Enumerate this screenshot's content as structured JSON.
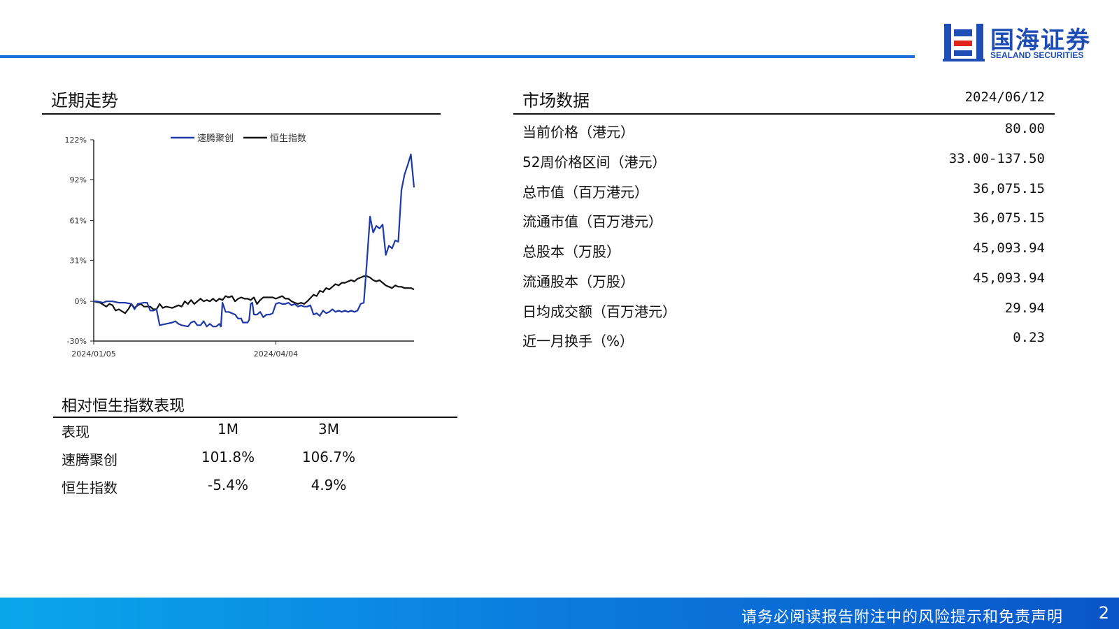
{
  "brand": {
    "name_cn": "国海证券",
    "name_en": "SEALAND SECURITIES",
    "primary_color": "#1f6fd6",
    "logo_blue": "#1d4db5",
    "logo_red": "#e2231a"
  },
  "trend": {
    "title": "近期走势"
  },
  "chart_data": {
    "type": "line",
    "title": "",
    "xlabel": "",
    "ylabel": "",
    "legend_position": "top",
    "ylim": [
      -30,
      122
    ],
    "y_ticks": [
      "122%",
      "92%",
      "61%",
      "31%",
      "0%",
      "-30%"
    ],
    "y_tick_values": [
      122,
      92,
      61,
      31,
      0,
      -30
    ],
    "x_ticks": [
      "2024/01/05",
      "2024/04/04"
    ],
    "x_tick_index": [
      0,
      58
    ],
    "n_points": 103,
    "series": [
      {
        "name": "速腾聚创",
        "color": "#1f3aa6",
        "points": [
          [
            0,
            0
          ],
          [
            1,
            0
          ],
          [
            3,
            -1
          ],
          [
            4,
            0
          ],
          [
            5,
            0
          ],
          [
            6,
            0
          ],
          [
            8,
            -1
          ],
          [
            10,
            -1
          ],
          [
            12,
            -2
          ],
          [
            13,
            -6
          ],
          [
            14,
            -2
          ],
          [
            16,
            -1
          ],
          [
            17,
            -1
          ],
          [
            18,
            -7
          ],
          [
            19,
            -7
          ],
          [
            20,
            -6
          ],
          [
            21,
            -18
          ],
          [
            23,
            -17
          ],
          [
            25,
            -16
          ],
          [
            26,
            -15
          ],
          [
            27,
            -17
          ],
          [
            28,
            -18
          ],
          [
            30,
            -19
          ],
          [
            31,
            -16
          ],
          [
            32,
            -15
          ],
          [
            33,
            -18
          ],
          [
            34,
            -18
          ],
          [
            35,
            -15
          ],
          [
            36,
            -19
          ],
          [
            37,
            -17
          ],
          [
            38,
            -19
          ],
          [
            39,
            -19
          ],
          [
            39.5,
            -18
          ],
          [
            40,
            -17
          ],
          [
            40.5,
            -19
          ],
          [
            41,
            -1
          ],
          [
            42,
            -8
          ],
          [
            43,
            -8
          ],
          [
            44,
            -9
          ],
          [
            45,
            -10
          ],
          [
            46,
            -13
          ],
          [
            47,
            -13
          ],
          [
            47.5,
            -16
          ],
          [
            48,
            -16
          ],
          [
            49,
            -16
          ],
          [
            49.5,
            -14
          ],
          [
            50,
            -2
          ],
          [
            50.5,
            -1
          ],
          [
            51,
            -10
          ],
          [
            52,
            -10
          ],
          [
            53,
            -8
          ],
          [
            54,
            -12
          ],
          [
            55,
            -10
          ],
          [
            56,
            -10
          ],
          [
            57,
            -9
          ],
          [
            58,
            -2
          ],
          [
            59,
            -1
          ],
          [
            60,
            -2
          ],
          [
            61,
            -2
          ],
          [
            62,
            -1
          ],
          [
            63,
            -3
          ],
          [
            64,
            -2
          ],
          [
            65,
            -4
          ],
          [
            66,
            -3
          ],
          [
            67,
            -4
          ],
          [
            68,
            -4
          ],
          [
            69,
            -3
          ],
          [
            70,
            -10
          ],
          [
            71,
            -9
          ],
          [
            72,
            -11
          ],
          [
            73,
            -7
          ],
          [
            74,
            -9
          ],
          [
            75,
            -8
          ],
          [
            76,
            -6
          ],
          [
            77,
            -8
          ],
          [
            78,
            -7
          ],
          [
            79,
            -8
          ],
          [
            80,
            -7
          ],
          [
            81,
            -8
          ],
          [
            82,
            -7
          ],
          [
            83,
            -8
          ],
          [
            84,
            -7
          ],
          [
            85,
            -2
          ],
          [
            86,
            -1
          ],
          [
            87,
            30
          ],
          [
            88,
            64
          ],
          [
            89,
            52
          ],
          [
            90,
            57
          ],
          [
            91,
            55
          ],
          [
            92,
            58
          ],
          [
            93,
            35
          ],
          [
            94,
            42
          ],
          [
            95,
            40
          ],
          [
            96,
            46
          ],
          [
            97,
            45
          ],
          [
            98,
            84
          ],
          [
            99,
            96
          ],
          [
            100,
            103
          ],
          [
            101,
            111
          ],
          [
            102,
            86
          ]
        ]
      },
      {
        "name": "恒生指数",
        "color": "#111111",
        "points": [
          [
            0,
            0
          ],
          [
            2,
            -1
          ],
          [
            4,
            -4
          ],
          [
            5,
            -2
          ],
          [
            6,
            -3
          ],
          [
            7,
            -7
          ],
          [
            8,
            -6
          ],
          [
            10,
            -9
          ],
          [
            11,
            -6
          ],
          [
            12,
            -2
          ],
          [
            13,
            -5
          ],
          [
            14,
            -3
          ],
          [
            15,
            -2
          ],
          [
            16,
            -4
          ],
          [
            17,
            -4
          ],
          [
            18,
            -4
          ],
          [
            19,
            -6
          ],
          [
            20,
            -6
          ],
          [
            21,
            -2
          ],
          [
            22,
            -5
          ],
          [
            23,
            -4
          ],
          [
            25,
            -5
          ],
          [
            27,
            -3
          ],
          [
            28,
            -4
          ],
          [
            29,
            0
          ],
          [
            30,
            -2
          ],
          [
            31,
            1
          ],
          [
            32,
            -2
          ],
          [
            33,
            0
          ],
          [
            34,
            2
          ],
          [
            35,
            0
          ],
          [
            36,
            1
          ],
          [
            37,
            0
          ],
          [
            38,
            2
          ],
          [
            39,
            0
          ],
          [
            40,
            2
          ],
          [
            41,
            1
          ],
          [
            42,
            4
          ],
          [
            43,
            3
          ],
          [
            44,
            4
          ],
          [
            45,
            0
          ],
          [
            46,
            2
          ],
          [
            47,
            3
          ],
          [
            48,
            2
          ],
          [
            49,
            2
          ],
          [
            50,
            1
          ],
          [
            51,
            3
          ],
          [
            52,
            -2
          ],
          [
            53,
            1
          ],
          [
            54,
            3
          ],
          [
            55,
            3
          ],
          [
            56,
            3
          ],
          [
            57,
            3
          ],
          [
            58,
            2
          ],
          [
            60,
            4
          ],
          [
            61,
            2
          ],
          [
            62,
            2
          ],
          [
            63,
            0
          ],
          [
            64,
            -1
          ],
          [
            65,
            -2
          ],
          [
            66,
            -1
          ],
          [
            67,
            -2
          ],
          [
            68,
            0
          ],
          [
            70,
            5
          ],
          [
            71,
            4
          ],
          [
            72,
            8
          ],
          [
            73,
            7
          ],
          [
            74,
            10
          ],
          [
            75,
            9
          ],
          [
            76,
            11
          ],
          [
            77,
            13
          ],
          [
            78,
            12
          ],
          [
            79,
            14
          ],
          [
            80,
            14
          ],
          [
            81,
            15
          ],
          [
            82,
            16
          ],
          [
            83,
            15
          ],
          [
            84,
            17
          ],
          [
            85,
            18
          ],
          [
            86,
            19
          ],
          [
            87,
            19
          ],
          [
            88,
            18
          ],
          [
            89,
            16
          ],
          [
            90,
            15
          ],
          [
            91,
            16
          ],
          [
            92,
            14
          ],
          [
            93,
            12
          ],
          [
            94,
            11
          ],
          [
            95,
            10
          ],
          [
            96,
            12
          ],
          [
            97,
            11
          ],
          [
            98,
            11
          ],
          [
            99,
            10
          ],
          [
            100,
            10
          ],
          [
            101,
            10
          ],
          [
            102,
            9
          ]
        ]
      }
    ]
  },
  "relative": {
    "title": "相对恒生指数表现",
    "headers": [
      "表现",
      "1M",
      "3M"
    ],
    "rows": [
      [
        "速腾聚创",
        "101.8%",
        "106.7%"
      ],
      [
        "恒生指数",
        "-5.4%",
        "4.9%"
      ]
    ]
  },
  "market": {
    "title": "市场数据",
    "date": "2024/06/12",
    "rows": [
      {
        "label": "当前价格（港元）",
        "value": "80.00"
      },
      {
        "label": "52周价格区间（港元）",
        "value": "33.00-137.50"
      },
      {
        "label": "总市值（百万港元）",
        "value": "36,075.15"
      },
      {
        "label": "流通市值（百万港元）",
        "value": "36,075.15"
      },
      {
        "label": "总股本（万股）",
        "value": "45,093.94"
      },
      {
        "label": "流通股本（万股）",
        "value": "45,093.94"
      },
      {
        "label": "日均成交额（百万港元）",
        "value": "29.94"
      },
      {
        "label": "近一月换手（%）",
        "value": "0.23"
      }
    ]
  },
  "footer": {
    "disclaimer": "请务必阅读报告附注中的风险提示和免责声明",
    "page_number": "2"
  }
}
